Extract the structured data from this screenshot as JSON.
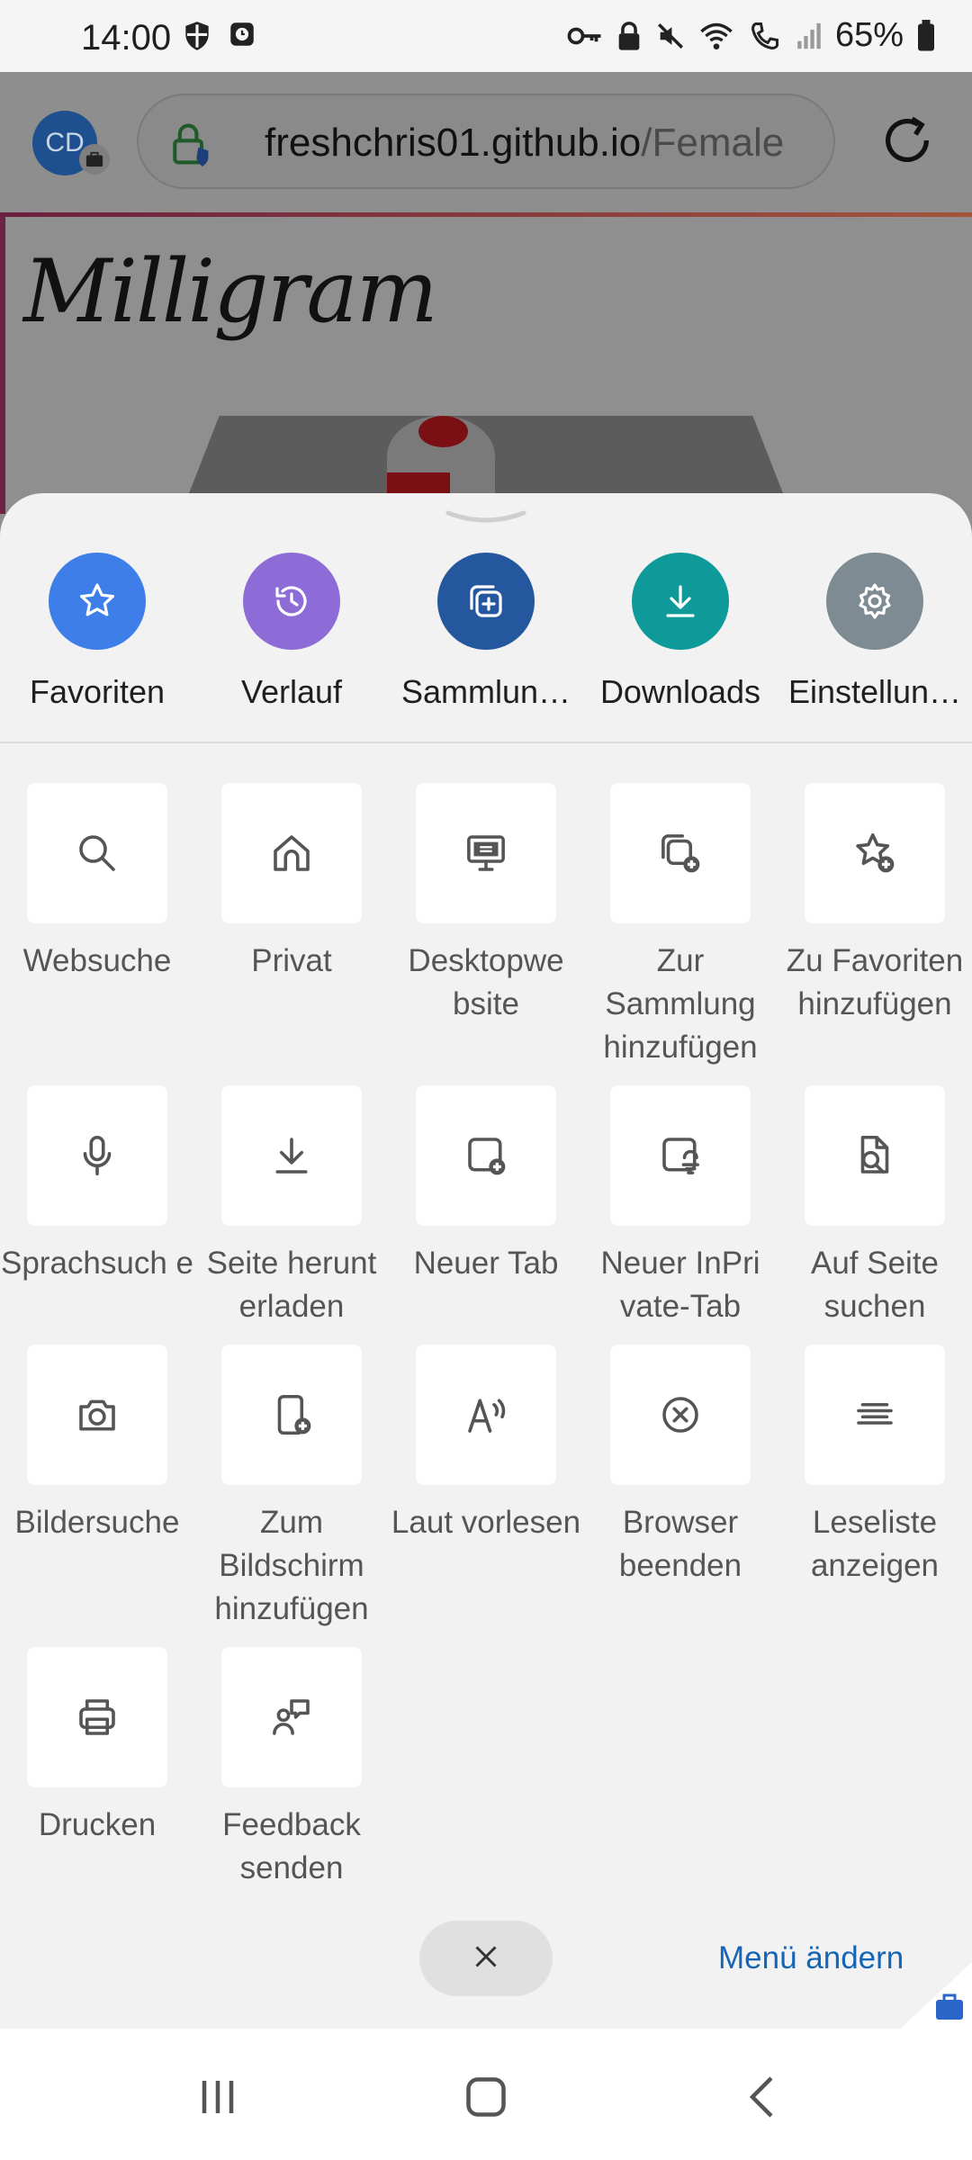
{
  "status_bar": {
    "time": "14:00",
    "battery": "65%",
    "icons": [
      "shield-icon",
      "clock-app-icon",
      "key-icon",
      "lock-icon",
      "mute-icon",
      "wifi-icon",
      "call-icon",
      "signal-icon",
      "battery-icon"
    ]
  },
  "browser": {
    "avatar_initials": "CD",
    "url_host": "freshchris01.github.io",
    "url_path": "/Female"
  },
  "page": {
    "logo_text": "Milligram"
  },
  "menu": {
    "top_items": [
      {
        "label": "Favoriten",
        "icon": "star-icon",
        "color": "#3d7ee8"
      },
      {
        "label": "Verlauf",
        "icon": "history-icon",
        "color": "#8e6cd8"
      },
      {
        "label": "Sammlun…",
        "icon": "collections-icon",
        "color": "#24579e"
      },
      {
        "label": "Downloads",
        "icon": "download-icon",
        "color": "#0f9a9a"
      },
      {
        "label": "Einstellun…",
        "icon": "gear-icon",
        "color": "#7e8b92"
      }
    ],
    "grid_items": [
      {
        "label": "Websuche",
        "icon": "search-icon"
      },
      {
        "label": "Privat",
        "icon": "home-icon"
      },
      {
        "label": "Desktopwe bsite",
        "icon": "desktop-icon"
      },
      {
        "label": "Zur Sammlung hinzufügen",
        "icon": "add-to-collection-icon"
      },
      {
        "label": "Zu Favoriten hinzufügen",
        "icon": "add-favorite-icon"
      },
      {
        "label": "Sprachsuch e",
        "icon": "microphone-icon"
      },
      {
        "label": "Seite herunt erladen",
        "icon": "download-page-icon"
      },
      {
        "label": "Neuer Tab",
        "icon": "new-tab-icon"
      },
      {
        "label": "Neuer InPri vate-Tab",
        "icon": "inprivate-tab-icon"
      },
      {
        "label": "Auf Seite suchen",
        "icon": "find-on-page-icon"
      },
      {
        "label": "Bildersuche",
        "icon": "camera-icon"
      },
      {
        "label": "Zum Bildschirm hinzufügen",
        "icon": "add-to-home-icon"
      },
      {
        "label": "Laut vorlesen",
        "icon": "read-aloud-icon"
      },
      {
        "label": "Browser beenden",
        "icon": "close-circle-icon"
      },
      {
        "label": "Leseliste anzeigen",
        "icon": "reading-list-icon"
      },
      {
        "label": "Drucken",
        "icon": "print-icon"
      },
      {
        "label": "Feedback senden",
        "icon": "feedback-icon"
      }
    ],
    "menu_change_label": "Menü ändern"
  }
}
